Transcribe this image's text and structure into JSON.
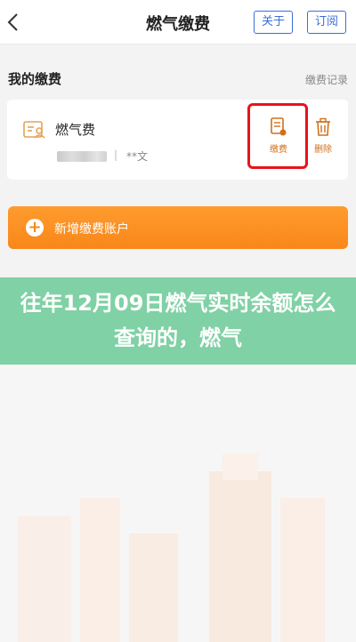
{
  "header": {
    "title": "燃气缴费",
    "about_label": "关于",
    "subscribe_label": "订阅"
  },
  "section": {
    "title": "我的缴费",
    "records_link": "缴费记录"
  },
  "bill": {
    "name": "燃气费",
    "account_separator": "|",
    "account_holder": "**文",
    "pay_label": "缴费",
    "delete_label": "删除"
  },
  "add_account": {
    "label": "新增缴费账户",
    "plus": "+"
  },
  "article": {
    "title": "往年12月09日燃气实时余额怎么查询的，燃气"
  },
  "colors": {
    "accent_blue": "#3b6fd6",
    "orange": "#f8871a",
    "highlight_red": "#e8131a",
    "banner_green": "#76cd9e"
  }
}
